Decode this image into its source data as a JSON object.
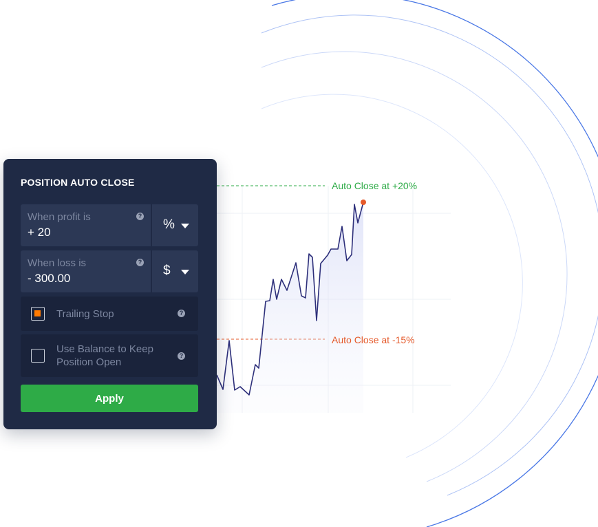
{
  "panel": {
    "title": "POSITION AUTO CLOSE",
    "profit": {
      "label": "When profit is",
      "value": "+ 20",
      "unit": "%"
    },
    "loss": {
      "label": "When loss is",
      "value": "- 300.00",
      "unit": "$"
    },
    "trailing_stop": {
      "label": "Trailing Stop",
      "checked": true
    },
    "use_balance": {
      "label": "Use Balance to Keep Position Open",
      "checked": false
    },
    "apply_label": "Apply",
    "help_glyph": "?"
  },
  "chart": {
    "take_profit_label": "Auto Close at +20%",
    "stop_loss_label": "Auto Close at -15%"
  },
  "colors": {
    "panel_bg": "#1f2a45",
    "field_bg": "#2c3855",
    "apply_green": "#2eab47",
    "profit_green": "#2eab47",
    "loss_red": "#e55a2b",
    "checkbox_orange": "#ff7a00",
    "price_line": "#2d2f7a"
  }
}
